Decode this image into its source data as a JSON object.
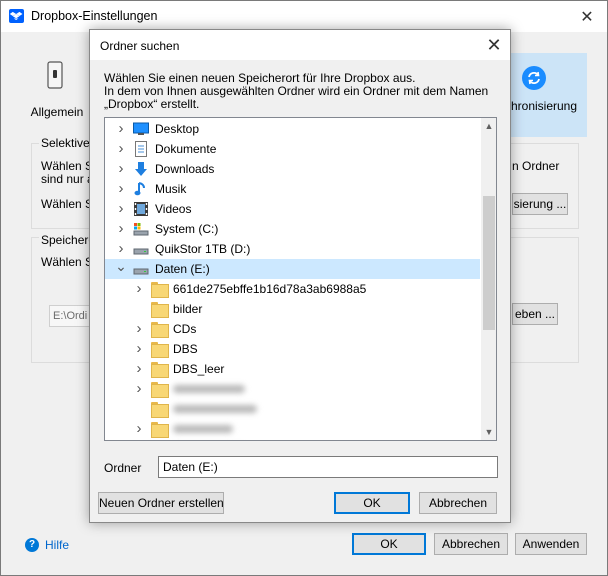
{
  "main": {
    "title": "Dropbox-Einstellungen",
    "close_glyph": "✕",
    "tabs": [
      {
        "label": "Allgemein"
      },
      {
        "label": "hronisierung"
      }
    ],
    "selective": {
      "heading": "Selektive S",
      "line1": "Wählen Sie",
      "line2": "sind nur au",
      "line3": "Wählen Sie",
      "right_text": "n Ordner",
      "button": "sierung ..."
    },
    "storage": {
      "heading": "Speichero",
      "line1": "Wählen Sie",
      "path_value": "E:\\Ordi",
      "button": "eben ..."
    },
    "help_label": "Hilfe",
    "ok_label": "OK",
    "cancel_label": "Abbrechen",
    "apply_label": "Anwenden"
  },
  "dialog": {
    "title": "Ordner suchen",
    "close_glyph": "✕",
    "description_line1": "Wählen Sie einen neuen Speicherort für Ihre Dropbox aus.",
    "description_line2": "In dem von Ihnen ausgewählten Ordner wird ein Ordner mit dem Namen",
    "description_line3": "„Dropbox“ erstellt.",
    "tree": [
      {
        "label": "Desktop",
        "icon": "desktop-icon",
        "level": 1,
        "expander": "collapsed"
      },
      {
        "label": "Dokumente",
        "icon": "documents-icon",
        "level": 1,
        "expander": "collapsed"
      },
      {
        "label": "Downloads",
        "icon": "downloads-icon",
        "level": 1,
        "expander": "collapsed"
      },
      {
        "label": "Musik",
        "icon": "music-icon",
        "level": 1,
        "expander": "collapsed"
      },
      {
        "label": "Videos",
        "icon": "videos-icon",
        "level": 1,
        "expander": "collapsed"
      },
      {
        "label": "System (C:)",
        "icon": "system-drive-icon",
        "level": 1,
        "expander": "collapsed"
      },
      {
        "label": "QuikStor 1TB (D:)",
        "icon": "drive-icon",
        "level": 1,
        "expander": "collapsed"
      },
      {
        "label": "Daten (E:)",
        "icon": "drive-icon",
        "level": 1,
        "expander": "expanded",
        "selected": true
      },
      {
        "label": "661de275ebffe1b16d78a3ab6988a5",
        "icon": "folder-icon",
        "level": 2,
        "expander": "collapsed"
      },
      {
        "label": "bilder",
        "icon": "folder-icon",
        "level": 2,
        "expander": "none"
      },
      {
        "label": "CDs",
        "icon": "folder-icon",
        "level": 2,
        "expander": "collapsed"
      },
      {
        "label": "DBS",
        "icon": "folder-icon",
        "level": 2,
        "expander": "collapsed"
      },
      {
        "label": "DBS_leer",
        "icon": "folder-icon",
        "level": 2,
        "expander": "collapsed"
      },
      {
        "label": "",
        "icon": "folder-icon",
        "level": 2,
        "expander": "collapsed",
        "blurred": true
      },
      {
        "label": "",
        "icon": "folder-icon",
        "level": 2,
        "expander": "none",
        "blurred": true
      },
      {
        "label": "",
        "icon": "folder-icon",
        "level": 2,
        "expander": "collapsed",
        "blurred": true
      },
      {
        "label": "",
        "icon": "folder-icon",
        "level": 2,
        "expander": "none",
        "blurred": true
      }
    ],
    "folder_label": "Ordner",
    "folder_value": "Daten (E:)",
    "new_folder_label": "Neuen Ordner erstellen",
    "ok_label": "OK",
    "cancel_label": "Abbrechen"
  },
  "colors": {
    "accent": "#0078d7",
    "selection": "#cce8ff",
    "folder": "#f8d775"
  }
}
